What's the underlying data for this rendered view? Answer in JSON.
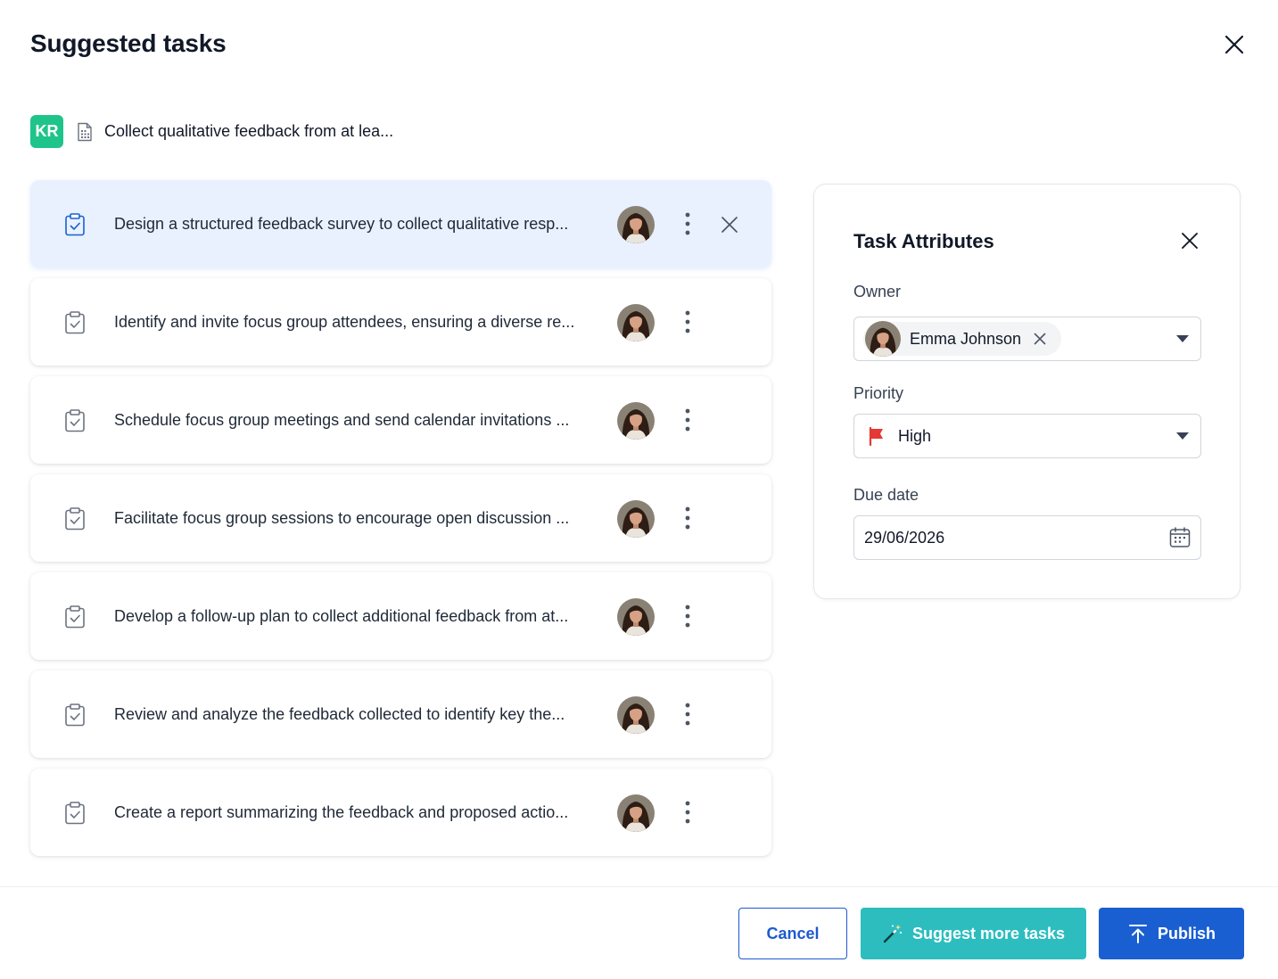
{
  "header": {
    "title": "Suggested tasks"
  },
  "objective": {
    "badge": "KR",
    "text": "Collect qualitative feedback from at lea..."
  },
  "tasks": [
    {
      "text": "Design a structured feedback survey to collect qualitative resp...",
      "selected": true
    },
    {
      "text": "Identify and invite focus group attendees, ensuring a diverse re...",
      "selected": false
    },
    {
      "text": "Schedule focus group meetings and send calendar invitations ...",
      "selected": false
    },
    {
      "text": "Facilitate focus group sessions to encourage open discussion ...",
      "selected": false
    },
    {
      "text": "Develop a follow-up plan to collect additional feedback from at...",
      "selected": false
    },
    {
      "text": "Review and analyze the feedback collected to identify key the...",
      "selected": false
    },
    {
      "text": "Create a report summarizing the feedback and proposed actio...",
      "selected": false
    }
  ],
  "panel": {
    "title": "Task Attributes",
    "owner_label": "Owner",
    "owner_name": "Emma Johnson",
    "priority_label": "Priority",
    "priority_value": "High",
    "due_label": "Due date",
    "due_value": "29/06/2026"
  },
  "footer": {
    "cancel": "Cancel",
    "suggest": "Suggest more tasks",
    "publish": "Publish"
  },
  "colors": {
    "accent": "#1a5fd1",
    "teal": "#2dbdbf",
    "kr_badge": "#1fc48a",
    "selected_bg": "#e8f1fd",
    "priority_flag": "#e53935"
  },
  "icons": {
    "modal_close": "close-icon",
    "objective": "document-icon",
    "task": "clipboard-check-icon",
    "more": "more-vertical-icon",
    "remove": "close-icon",
    "priority": "flag-icon",
    "due": "calendar-icon",
    "suggest": "magic-wand-icon",
    "publish": "upload-arrow-icon"
  }
}
